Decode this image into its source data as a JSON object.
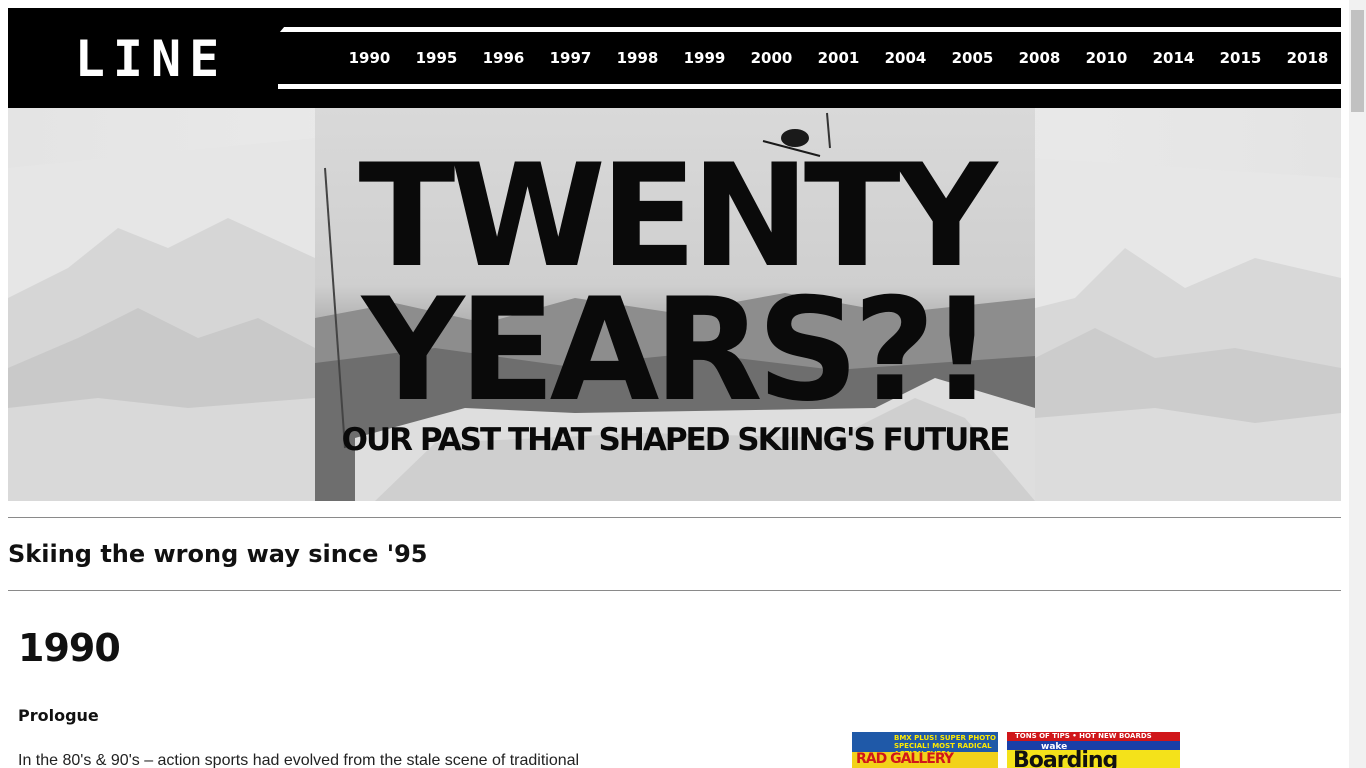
{
  "header": {
    "logo_text": "LINE",
    "nav_items": [
      "1990",
      "1995",
      "1996",
      "1997",
      "1998",
      "1999",
      "2000",
      "2001",
      "2004",
      "2005",
      "2008",
      "2010",
      "2014",
      "2015",
      "2018"
    ]
  },
  "hero": {
    "title_line1": "TWENTY",
    "title_line2": "YEARS?!",
    "subtitle": "OUR PAST THAT SHAPED SKIING'S FUTURE"
  },
  "main": {
    "tagline": "Skiing the wrong way since '95",
    "year": "1990",
    "section_label": "Prologue",
    "body_text": "In the 80's & 90's – action sports had evolved from the stale scene of traditional"
  },
  "magazines": {
    "mag1_top": "BMX PLUS! SUPER PHOTO SPECIAL! MOST RADICAL ACTION EVER!",
    "mag1_title": "RAD GALLERY",
    "mag2_top": "TONS OF TIPS • HOT NEW BOARDS",
    "mag2_sub": "wake",
    "mag2_title": "Boarding"
  },
  "colors": {
    "header_bg": "#000000",
    "nav_text": "#ffffff"
  }
}
